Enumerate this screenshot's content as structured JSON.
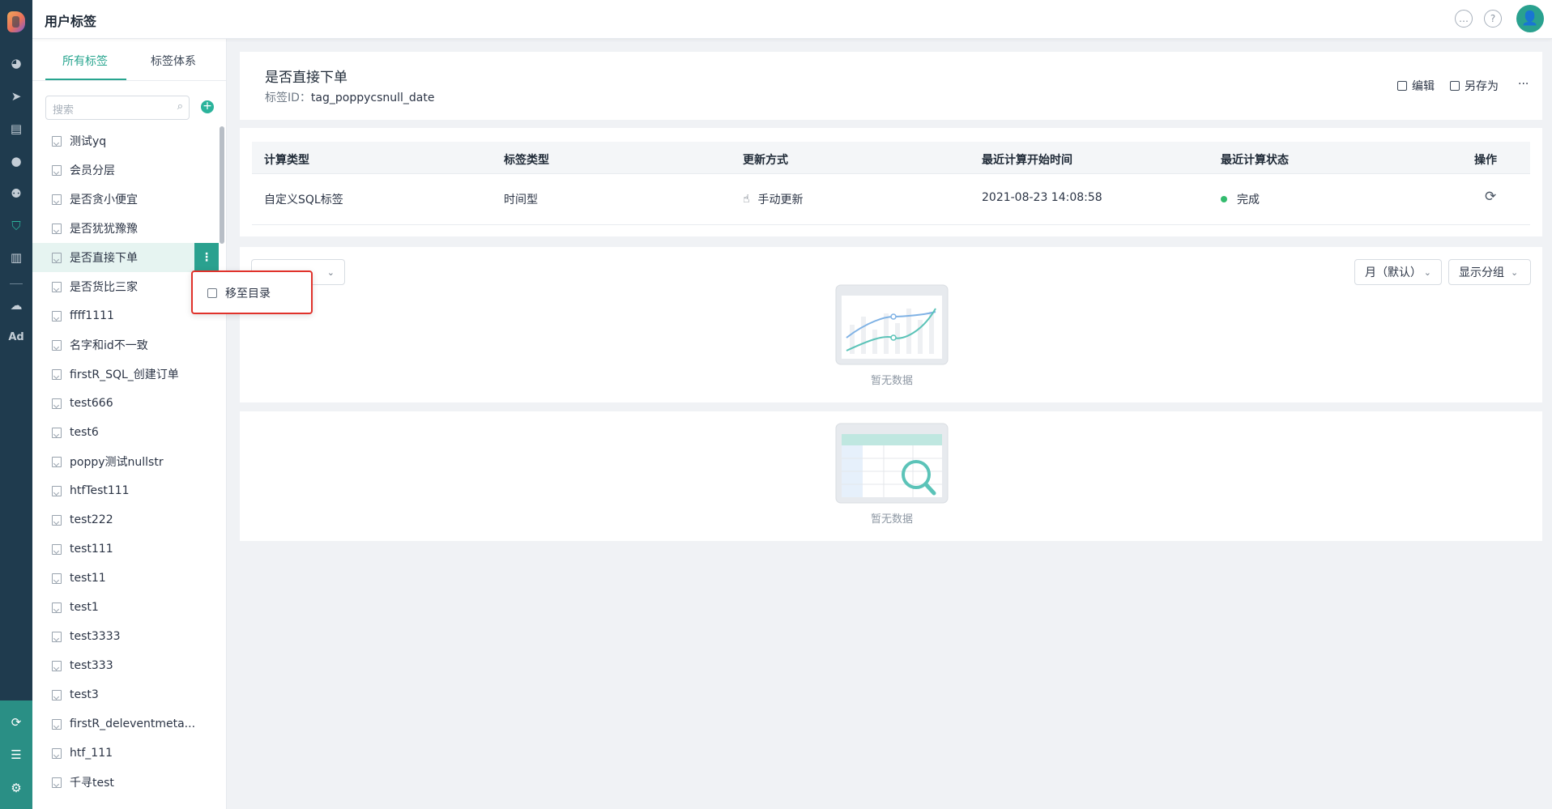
{
  "app": {
    "title": "用户标签"
  },
  "colors": {
    "accent": "#2aa18f",
    "rail": "#1f3b4e",
    "highlight": "#e0322b",
    "success": "#33bb6e"
  },
  "rail": {
    "items": [
      "dashboard-icon",
      "send-icon",
      "table-icon",
      "user-icon",
      "users-icon",
      "tag-icon",
      "bar-chart-icon",
      "wechat-icon",
      "Ad",
      "sync-icon",
      "server-icon",
      "settings-icon"
    ],
    "ad_label": "Ad"
  },
  "sidebar": {
    "tabs": [
      {
        "label": "所有标签"
      },
      {
        "label": "标签体系"
      }
    ],
    "search_placeholder": "搜索",
    "items": [
      {
        "label": "测试yq"
      },
      {
        "label": "会员分层"
      },
      {
        "label": "是否贪小便宜"
      },
      {
        "label": "是否犹犹豫豫"
      },
      {
        "label": "是否直接下单"
      },
      {
        "label": "是否货比三家"
      },
      {
        "label": "ffff1111"
      },
      {
        "label": "名字和id不一致"
      },
      {
        "label": "firstR_SQL_创建订单"
      },
      {
        "label": "test666"
      },
      {
        "label": "test6"
      },
      {
        "label": "poppy测试nullstr"
      },
      {
        "label": "htfTest111"
      },
      {
        "label": "test222"
      },
      {
        "label": "test111"
      },
      {
        "label": "test11"
      },
      {
        "label": "test1"
      },
      {
        "label": "test3333"
      },
      {
        "label": "test333"
      },
      {
        "label": "test3"
      },
      {
        "label": "firstR_deleventmeta..."
      },
      {
        "label": "htf_111"
      },
      {
        "label": "千寻test"
      }
    ],
    "selected_index": 4,
    "more_label": "⋮"
  },
  "context_menu": {
    "items": [
      {
        "label": "移至目录"
      }
    ]
  },
  "header": {
    "tag_name": "是否直接下单",
    "id_label": "标签ID：",
    "id_value": "tag_poppycsnull_date",
    "actions": {
      "edit": "编辑",
      "save_as": "另存为",
      "more": "···"
    }
  },
  "table": {
    "columns": [
      "计算类型",
      "标签类型",
      "更新方式",
      "最近计算开始时间",
      "最近计算状态",
      "操作"
    ],
    "rows": [
      {
        "calc_type": "自定义SQL标签",
        "tag_type": "时间型",
        "update_mode": "手动更新",
        "last_start": "2021-08-23 14:08:58",
        "status": "完成"
      }
    ]
  },
  "chart_panel": {
    "left_select": "",
    "granularity": "月（默认）",
    "group_select": "显示分组",
    "empty_text": "暂无数据"
  },
  "detail_panel": {
    "empty_text": "暂无数据"
  }
}
